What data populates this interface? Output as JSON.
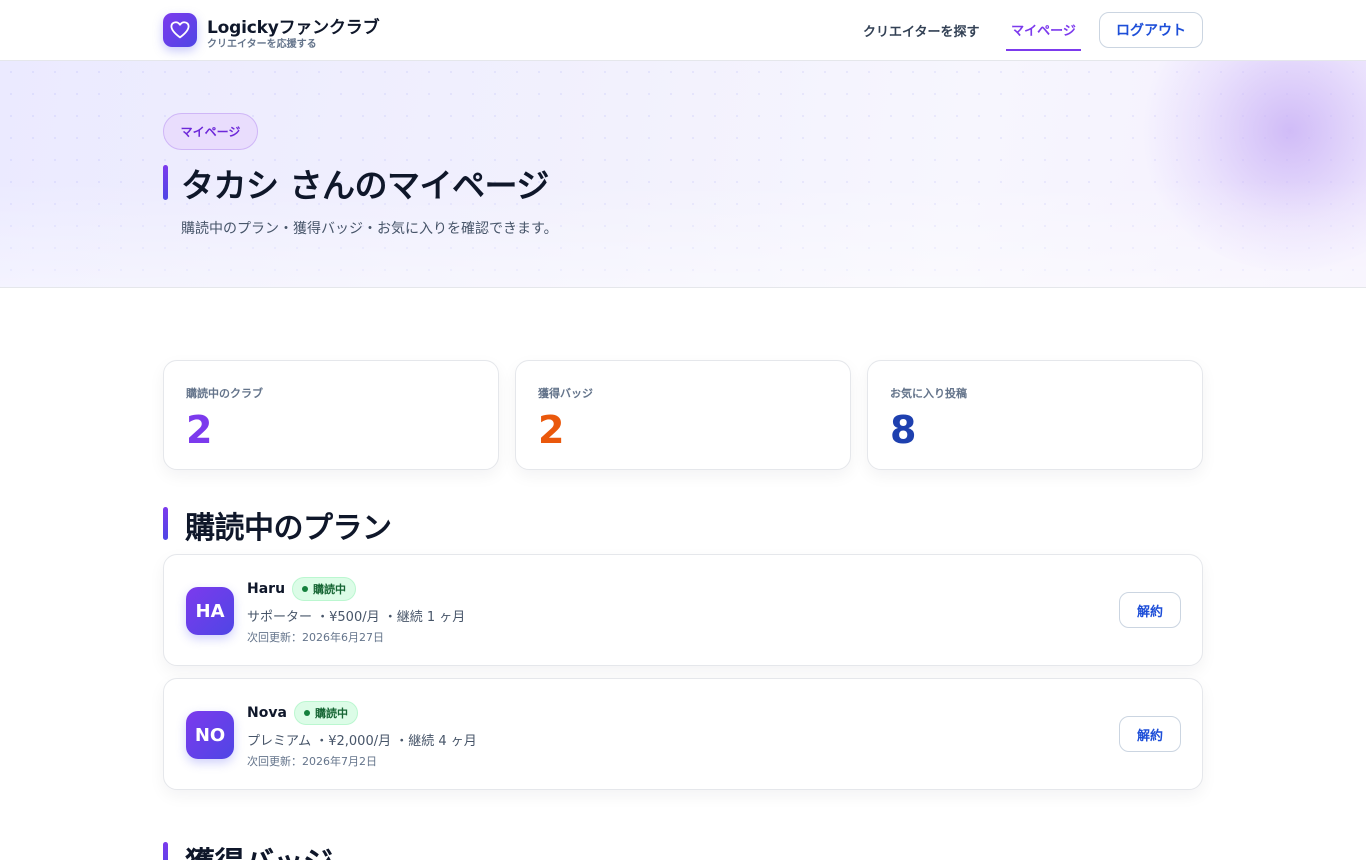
{
  "header": {
    "brand_title": "Logickyファンクラブ",
    "brand_sub": "クリエイターを応援する",
    "nav_find": "クリエイターを探す",
    "nav_mypage": "マイページ",
    "logout": "ログアウト"
  },
  "hero": {
    "pill": "マイページ",
    "title": "タカシ さんのマイページ",
    "subtitle": "購読中のプラン・獲得バッジ・お気に入りを確認できます。"
  },
  "stats": [
    {
      "label": "購読中のクラブ",
      "value": "2",
      "color": "#7c3aed"
    },
    {
      "label": "獲得バッジ",
      "value": "2",
      "color": "#ea580c"
    },
    {
      "label": "お気に入り投稿",
      "value": "8",
      "color": "#1e40af"
    }
  ],
  "plans_section": {
    "title": "購読中のプラン",
    "items": [
      {
        "initials": "HA",
        "name": "Haru",
        "status": "購読中",
        "detail": "サポーター ・¥500/月 ・継続 1 ヶ月",
        "renewal": "次回更新：2026年6月27日",
        "cancel_label": "解約"
      },
      {
        "initials": "NO",
        "name": "Nova",
        "status": "購読中",
        "detail": "プレミアム ・¥2,000/月 ・継続 4 ヶ月",
        "renewal": "次回更新：2026年7月2日",
        "cancel_label": "解約"
      }
    ]
  },
  "badges_section": {
    "title": "獲得バッジ"
  }
}
